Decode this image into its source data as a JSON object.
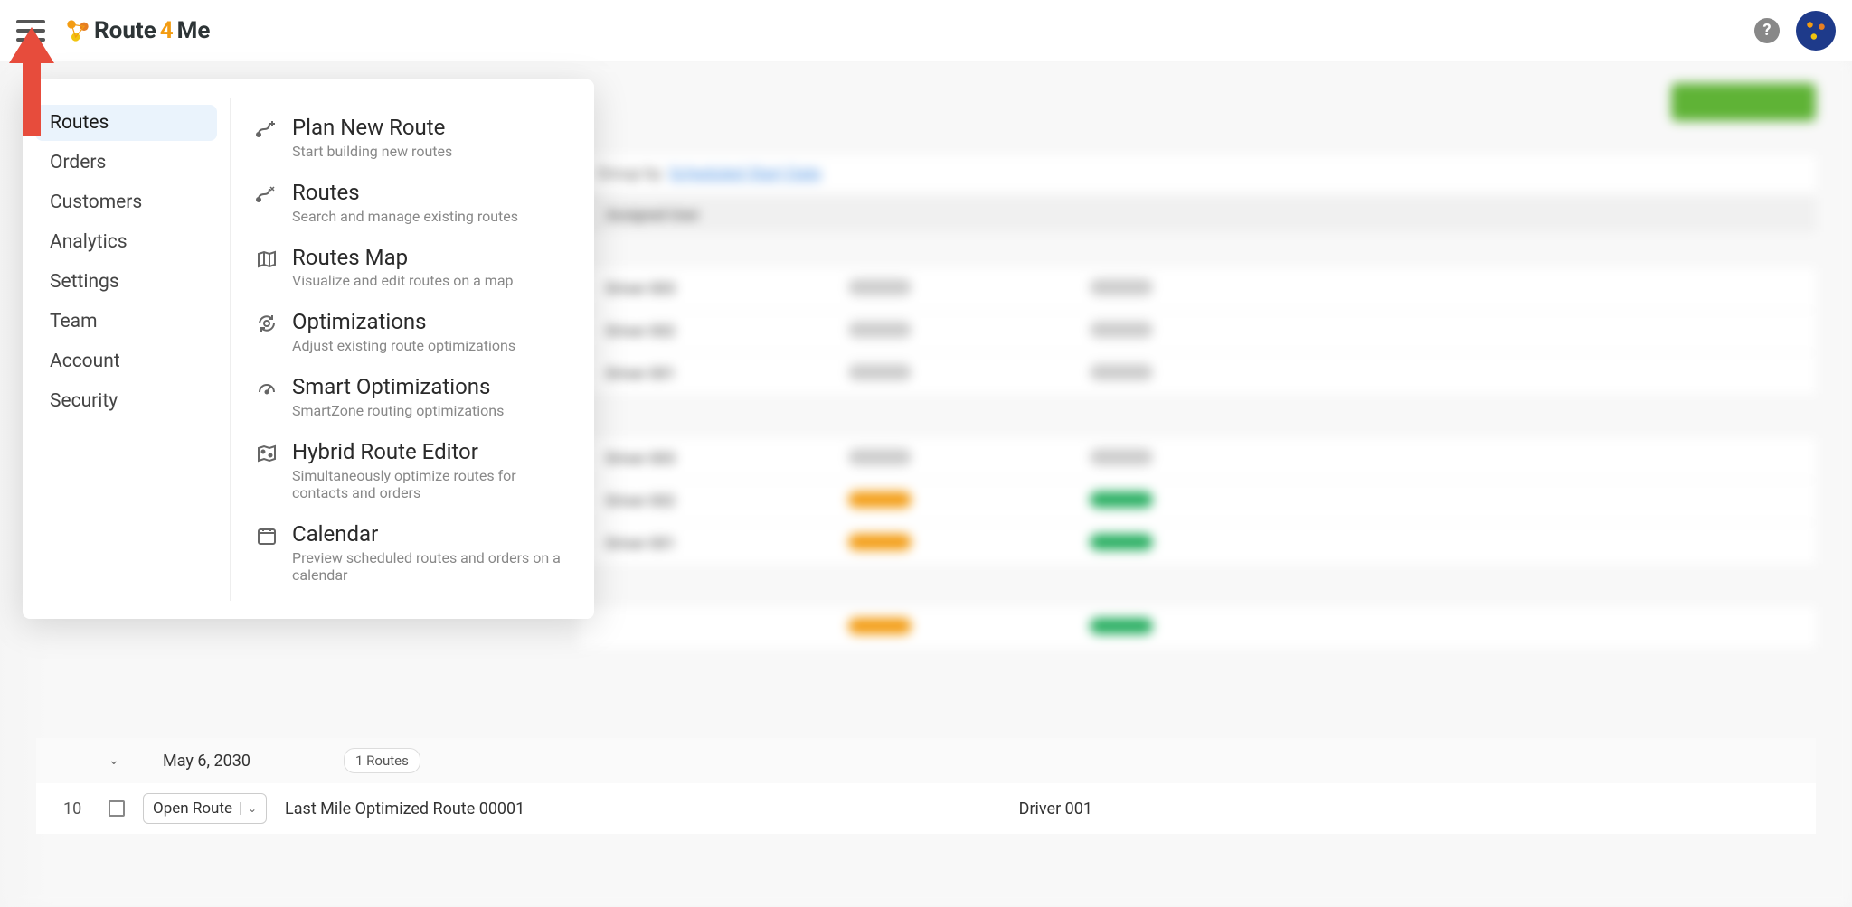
{
  "header": {
    "brand_route": "Route",
    "brand_four": "4",
    "brand_me": "Me",
    "help_glyph": "?"
  },
  "menu": {
    "left_items": [
      "Routes",
      "Orders",
      "Customers",
      "Analytics",
      "Settings",
      "Team",
      "Account",
      "Security"
    ],
    "right_entries": [
      {
        "title": "Plan New Route",
        "sub": "Start building new routes"
      },
      {
        "title": "Routes",
        "sub": "Search and manage existing routes"
      },
      {
        "title": "Routes Map",
        "sub": "Visualize and edit routes on a map"
      },
      {
        "title": "Optimizations",
        "sub": "Adjust existing route optimizations"
      },
      {
        "title": "Smart Optimizations",
        "sub": "SmartZone routing optimizations"
      },
      {
        "title": "Hybrid Route Editor",
        "sub": "Simultaneously optimize routes for contacts and orders"
      },
      {
        "title": "Calendar",
        "sub": "Preview scheduled routes and orders on a calendar"
      }
    ]
  },
  "bg": {
    "group_by_label": "Group by",
    "group_by_value": "Scheduled Start Date",
    "col_assigned": "Assigned User",
    "drivers": [
      "Driver 003",
      "Driver 002",
      "Driver 001",
      "Driver 003",
      "Driver 002",
      "Driver 001"
    ]
  },
  "clear": {
    "group_date": "May 6, 2030",
    "group_badge": "1 Routes",
    "row_num": "10",
    "open_label": "Open Route",
    "route_name": "Last Mile Optimized Route 00001",
    "row_driver": "Driver 001"
  }
}
